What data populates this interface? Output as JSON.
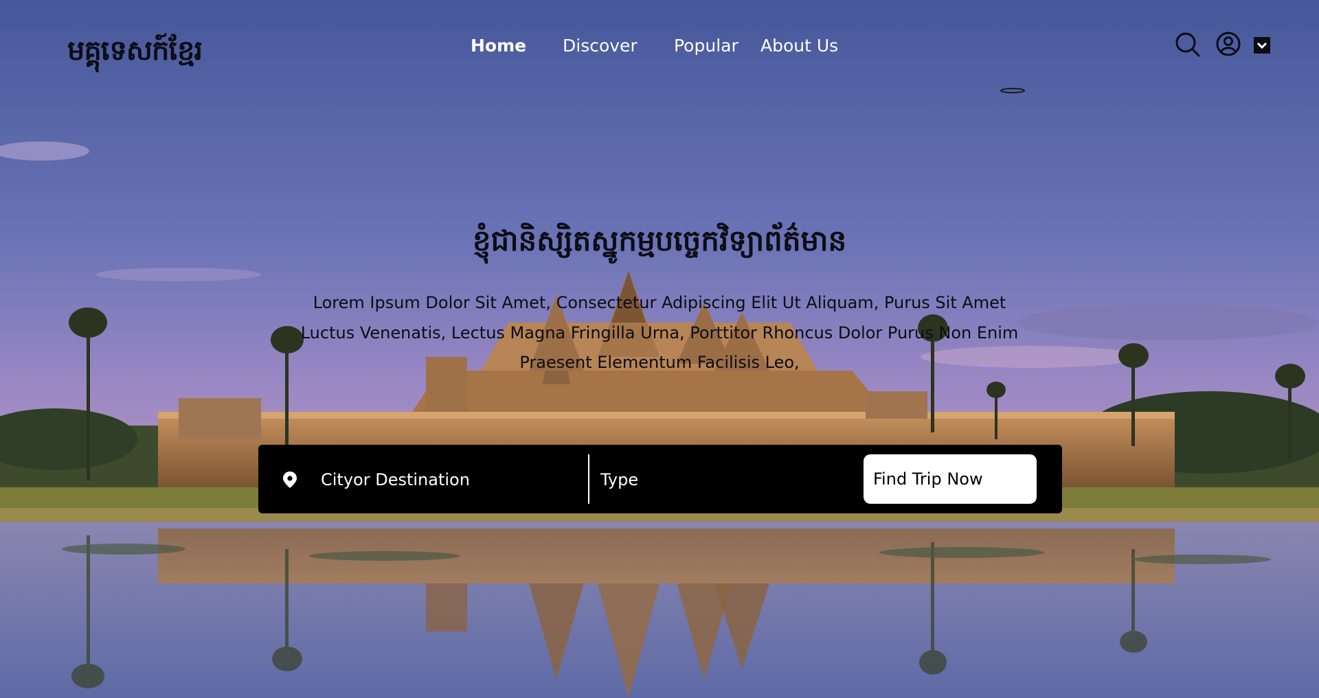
{
  "brand": {
    "logo_text": "មគ្គុទេសក៍ខ្មែរ"
  },
  "nav": {
    "items": [
      {
        "label": "Home",
        "active": true
      },
      {
        "label": "Discover",
        "active": false
      },
      {
        "label": "Popular",
        "active": false
      },
      {
        "label": "About Us",
        "active": false
      }
    ],
    "icons": [
      "search-icon",
      "user-icon",
      "chevron-down-icon"
    ]
  },
  "hero": {
    "title": "ខ្ញុំជានិស្សិតស្នូកម្មបច្ចេកវិទ្យាព័ត៌មាន",
    "description": "Lorem Ipsum Dolor Sit Amet, Consectetur Adipiscing Elit Ut Aliquam, Purus Sit Amet Luctus Venenatis, Lectus Magna Fringilla Urna, Porttitor Rhoncus Dolor Purus Non Enim Praesent Elementum Facilisis Leo,"
  },
  "search": {
    "destination_placeholder": "Cityor Destination",
    "type_placeholder": "Type",
    "button_label": "Find Trip Now"
  },
  "colors": {
    "sky_top": "#4d5d9d",
    "sky_mid": "#8f83c2",
    "temple": "#b98758",
    "water": "#7e86b5",
    "text_dark": "#0c0c14",
    "search_bg": "#000000",
    "button_bg": "#ffffff"
  }
}
